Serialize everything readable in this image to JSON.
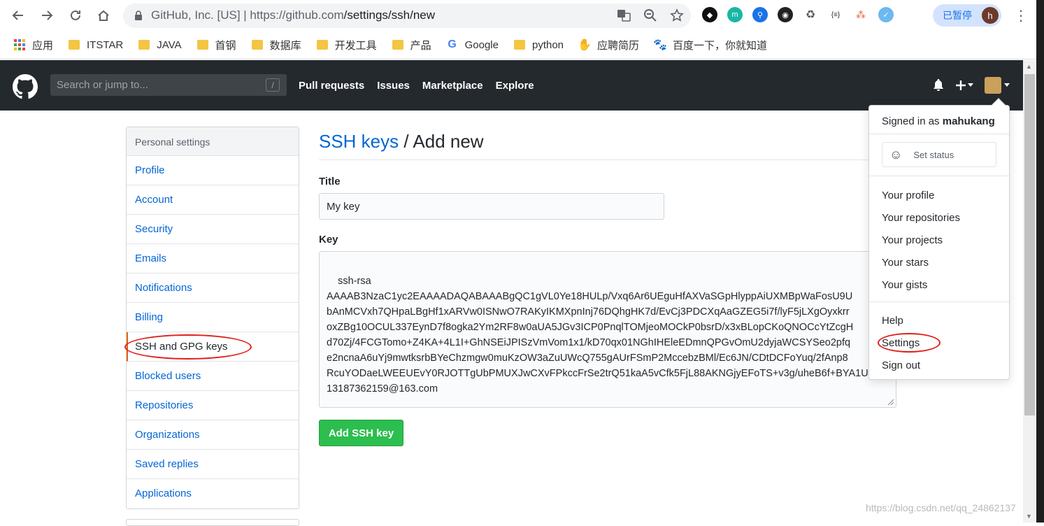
{
  "browser": {
    "site_identity": "GitHub, Inc. [US]",
    "url_domain": "https://github.com",
    "url_path": "/settings/ssh/new",
    "paused_label": "已暂停",
    "profile_initial": "h"
  },
  "bookmarks": [
    "应用",
    "ITSTAR",
    "JAVA",
    "首钢",
    "数据库",
    "开发工具",
    "产品",
    "Google",
    "python",
    "应聘简历",
    "百度一下，你就知道"
  ],
  "header": {
    "search_placeholder": "Search or jump to...",
    "slash_key": "/",
    "nav": [
      "Pull requests",
      "Issues",
      "Marketplace",
      "Explore"
    ]
  },
  "sidebar": {
    "heading": "Personal settings",
    "items": [
      "Profile",
      "Account",
      "Security",
      "Emails",
      "Notifications",
      "Billing",
      "SSH and GPG keys",
      "Blocked users",
      "Repositories",
      "Organizations",
      "Saved replies",
      "Applications"
    ],
    "selected": "SSH and GPG keys"
  },
  "main": {
    "title_link": "SSH keys",
    "title_rest": " / Add new",
    "title_label": "Title",
    "title_value": "My key",
    "key_label": "Key",
    "key_value": "ssh-rsa\nAAAAB3NzaC1yc2EAAAADAQABAAABgQC1gVL0Ye18HULp/Vxq6Ar6UEguHfAXVaSGpHlyppAiUXMBpWaFosU9U\nbAnMCVxh7QHpaLBgHf1xARVw0ISNwO7RAKyIKMXpnInj76DQhgHK7d/EvCj3PDCXqAaGZEG5i7f/lyF5jLXgOyxkrr\noxZBg10OCUL337EynD7f8ogka2Ym2RF8w0aUA5JGv3ICP0PnqlTOMjeoMOCkP0bsrD/x3xBLopCKoQNOCcYtZcgH\nd70Zj/4FCGTomo+Z4KA+4L1I+GhNSEiJPISzVmVom1x1/kD70qx01NGhIHEleEDmnQPGvOmU2dyjaWCSYSeo2pfq\ne2ncnaA6uYj9mwtksrbBYeChzmgw0muKzOW3aZuUWcQ755gAUrFSmP2MccebzBMl/Ec6JN/CDtDCFoYuq/2fAnp8\nRcuYODaeLWEEUEvY0RJOTTgUbPMUXJwCXvFPkccFrSe2trQ51kaA5vCfk5FjL88AKNGjyEFoTS+v3g/uheB6f+BYA1U\n13187362159@163.com",
    "submit_label": "Add SSH key"
  },
  "dropdown": {
    "signed_prefix": "Signed in as ",
    "username": "mahukang",
    "set_status": "Set status",
    "items_a": [
      "Your profile",
      "Your repositories",
      "Your projects",
      "Your stars",
      "Your gists"
    ],
    "items_b": [
      "Help",
      "Settings",
      "Sign out"
    ]
  },
  "watermark": "https://blog.csdn.net/qq_24862137",
  "colors": {
    "header_bg": "#24292e",
    "link": "#0366d6",
    "button_green": "#2cbe4e",
    "annotation_red": "#e0201a"
  }
}
